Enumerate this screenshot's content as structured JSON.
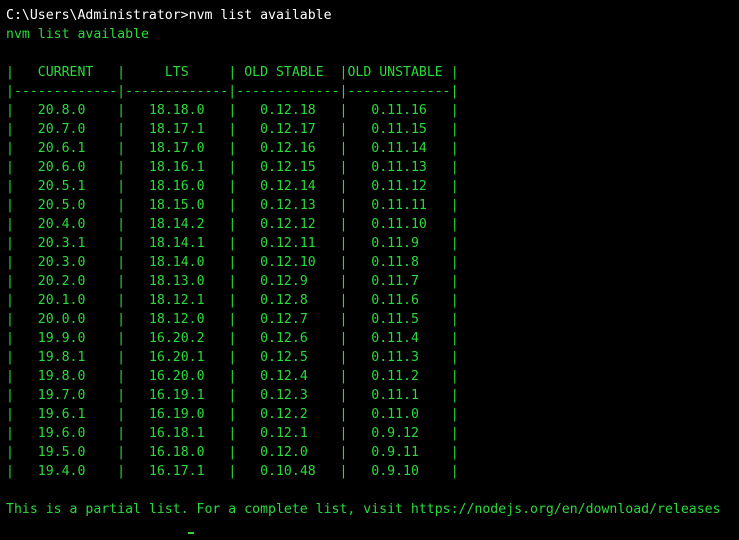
{
  "terminal": {
    "command_prompt": "C:\\Users\\Administrator>",
    "command_text": "nvm list available",
    "echo_line": "nvm list available",
    "headers": [
      "CURRENT",
      "LTS",
      "OLD STABLE",
      "OLD UNSTABLE"
    ],
    "rows": [
      [
        "20.8.0",
        "18.18.0",
        "0.12.18",
        "0.11.16"
      ],
      [
        "20.7.0",
        "18.17.1",
        "0.12.17",
        "0.11.15"
      ],
      [
        "20.6.1",
        "18.17.0",
        "0.12.16",
        "0.11.14"
      ],
      [
        "20.6.0",
        "18.16.1",
        "0.12.15",
        "0.11.13"
      ],
      [
        "20.5.1",
        "18.16.0",
        "0.12.14",
        "0.11.12"
      ],
      [
        "20.5.0",
        "18.15.0",
        "0.12.13",
        "0.11.11"
      ],
      [
        "20.4.0",
        "18.14.2",
        "0.12.12",
        "0.11.10"
      ],
      [
        "20.3.1",
        "18.14.1",
        "0.12.11",
        "0.11.9"
      ],
      [
        "20.3.0",
        "18.14.0",
        "0.12.10",
        "0.11.8"
      ],
      [
        "20.2.0",
        "18.13.0",
        "0.12.9",
        "0.11.7"
      ],
      [
        "20.1.0",
        "18.12.1",
        "0.12.8",
        "0.11.6"
      ],
      [
        "20.0.0",
        "18.12.0",
        "0.12.7",
        "0.11.5"
      ],
      [
        "19.9.0",
        "16.20.2",
        "0.12.6",
        "0.11.4"
      ],
      [
        "19.8.1",
        "16.20.1",
        "0.12.5",
        "0.11.3"
      ],
      [
        "19.8.0",
        "16.20.0",
        "0.12.4",
        "0.11.2"
      ],
      [
        "19.7.0",
        "16.19.1",
        "0.12.3",
        "0.11.1"
      ],
      [
        "19.6.1",
        "16.19.0",
        "0.12.2",
        "0.11.0"
      ],
      [
        "19.6.0",
        "16.18.1",
        "0.12.1",
        "0.9.12"
      ],
      [
        "19.5.0",
        "16.18.0",
        "0.12.0",
        "0.9.11"
      ],
      [
        "19.4.0",
        "16.17.1",
        "0.10.48",
        "0.9.10"
      ]
    ],
    "footer": "This is a partial list. For a complete list, visit https://nodejs.org/en/download/releases"
  },
  "colors": {
    "background": "#000000",
    "text": "#2bd93a",
    "command": "#ffffff"
  }
}
